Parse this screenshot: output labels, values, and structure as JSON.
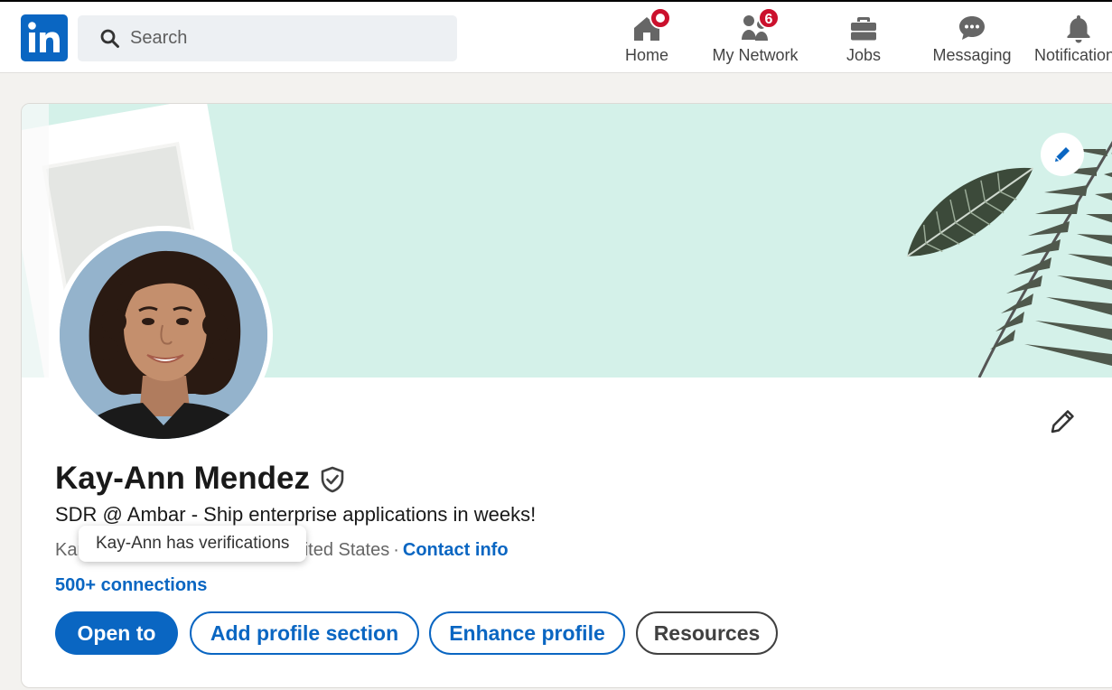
{
  "nav": {
    "logo_text": "in",
    "search": {
      "placeholder": "Search"
    },
    "items": [
      {
        "label": "Home",
        "icon": "home-icon",
        "badge": ""
      },
      {
        "label": "My Network",
        "icon": "network-icon",
        "badge": "6"
      },
      {
        "label": "Jobs",
        "icon": "jobs-icon",
        "badge": ""
      },
      {
        "label": "Messaging",
        "icon": "messaging-icon",
        "badge": ""
      },
      {
        "label": "Notifications",
        "icon": "bell-icon",
        "badge": ""
      }
    ]
  },
  "profile": {
    "name": "Kay-Ann Mendez",
    "headline": "SDR @ Ambar - Ship enterprise applications in weeks!",
    "location": "Kannapolis, North Carolina, United States",
    "separator": "·",
    "contact_info": "Contact info",
    "connections": "500+ connections",
    "tooltip": "Kay-Ann has verifications"
  },
  "actions": {
    "open_to": "Open to",
    "add_section": "Add profile section",
    "enhance": "Enhance profile",
    "resources": "Resources"
  },
  "colors": {
    "brand": "#0a66c2",
    "badge": "#cb112d",
    "banner": "#d4f1e9",
    "page_bg": "#f3f2ef"
  }
}
